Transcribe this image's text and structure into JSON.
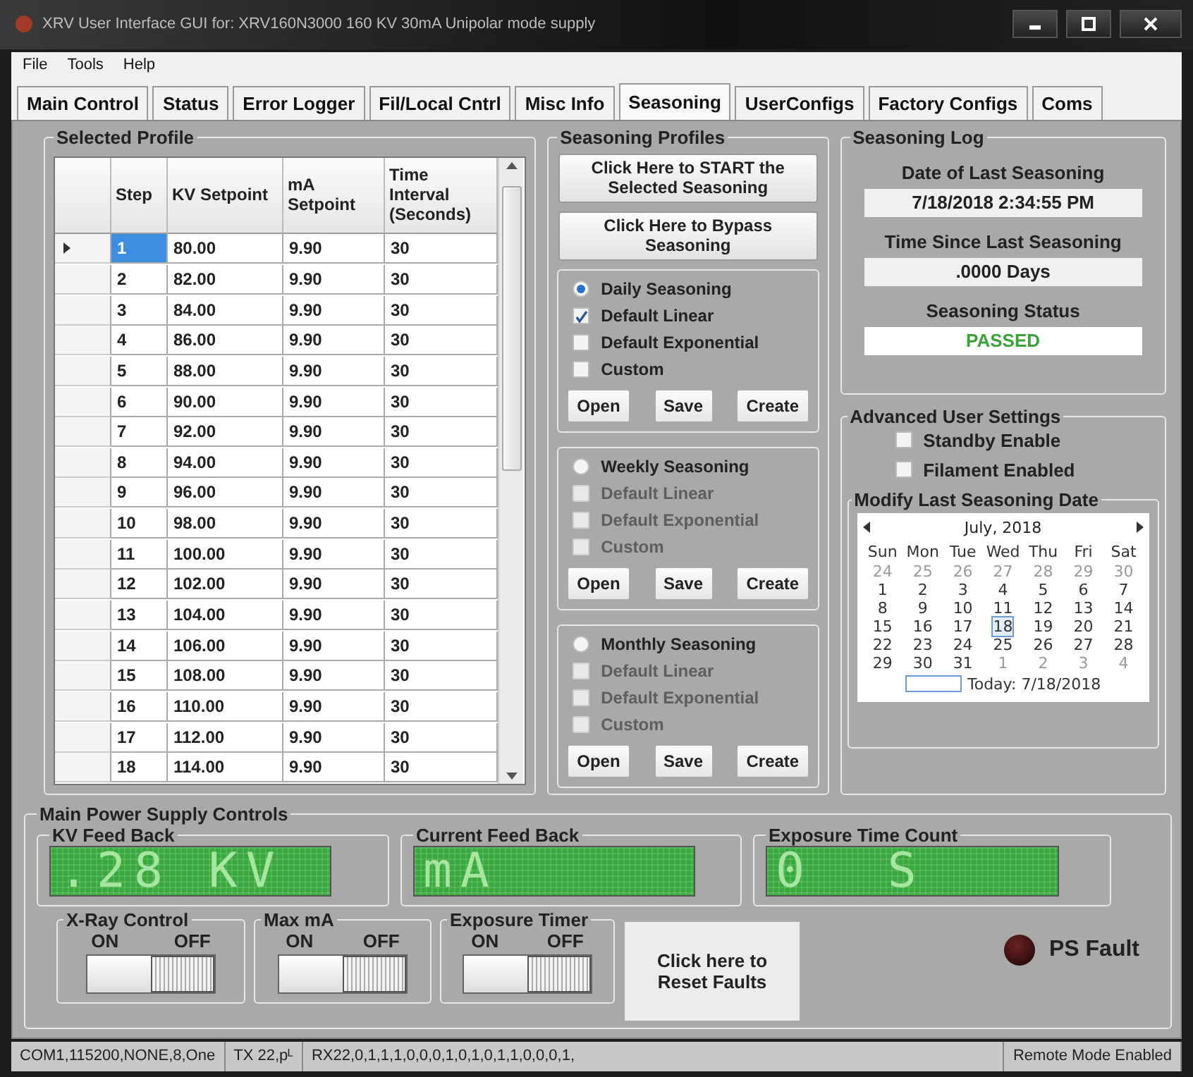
{
  "window": {
    "title": "XRV User Interface GUI for: XRV160N3000 160 KV 30mA Unipolar mode supply"
  },
  "menu": [
    "File",
    "Tools",
    "Help"
  ],
  "tabs": [
    {
      "label": "Main Control",
      "selected": false
    },
    {
      "label": "Status",
      "selected": false
    },
    {
      "label": "Error Logger",
      "selected": false
    },
    {
      "label": "Fil/Local Cntrl",
      "selected": false
    },
    {
      "label": "Misc Info",
      "selected": false
    },
    {
      "label": "Seasoning",
      "selected": true
    },
    {
      "label": "UserConfigs",
      "selected": false
    },
    {
      "label": "Factory Configs",
      "selected": false
    },
    {
      "label": "Coms",
      "selected": false
    }
  ],
  "selected_profile": {
    "title": "Selected Profile",
    "columns": [
      "Step",
      "KV Setpoint",
      "mA Setpoint",
      "Time Interval (Seconds)"
    ],
    "rows": [
      {
        "cells": [
          "1",
          "80.00",
          "9.90",
          "30"
        ],
        "selected": true
      },
      {
        "cells": [
          "2",
          "82.00",
          "9.90",
          "30"
        ],
        "selected": false
      },
      {
        "cells": [
          "3",
          "84.00",
          "9.90",
          "30"
        ],
        "selected": false
      },
      {
        "cells": [
          "4",
          "86.00",
          "9.90",
          "30"
        ],
        "selected": false
      },
      {
        "cells": [
          "5",
          "88.00",
          "9.90",
          "30"
        ],
        "selected": false
      },
      {
        "cells": [
          "6",
          "90.00",
          "9.90",
          "30"
        ],
        "selected": false
      },
      {
        "cells": [
          "7",
          "92.00",
          "9.90",
          "30"
        ],
        "selected": false
      },
      {
        "cells": [
          "8",
          "94.00",
          "9.90",
          "30"
        ],
        "selected": false
      },
      {
        "cells": [
          "9",
          "96.00",
          "9.90",
          "30"
        ],
        "selected": false
      },
      {
        "cells": [
          "10",
          "98.00",
          "9.90",
          "30"
        ],
        "selected": false
      },
      {
        "cells": [
          "11",
          "100.00",
          "9.90",
          "30"
        ],
        "selected": false
      },
      {
        "cells": [
          "12",
          "102.00",
          "9.90",
          "30"
        ],
        "selected": false
      },
      {
        "cells": [
          "13",
          "104.00",
          "9.90",
          "30"
        ],
        "selected": false
      },
      {
        "cells": [
          "14",
          "106.00",
          "9.90",
          "30"
        ],
        "selected": false
      },
      {
        "cells": [
          "15",
          "108.00",
          "9.90",
          "30"
        ],
        "selected": false
      },
      {
        "cells": [
          "16",
          "110.00",
          "9.90",
          "30"
        ],
        "selected": false
      },
      {
        "cells": [
          "17",
          "112.00",
          "9.90",
          "30"
        ],
        "selected": false
      },
      {
        "cells": [
          "18",
          "114.00",
          "9.90",
          "30"
        ],
        "selected": false
      }
    ]
  },
  "seasoning_profiles": {
    "title": "Seasoning Profiles",
    "buttons": [
      "Click Here to START the Selected Seasoning",
      "Click Here to Bypass Seasoning"
    ],
    "groups": [
      {
        "label": "Daily Seasoning",
        "selected": true,
        "disabled": false,
        "options": [
          {
            "label": "Default Linear",
            "checked": true
          },
          {
            "label": "Default Exponential",
            "checked": false
          },
          {
            "label": "Custom",
            "checked": false
          }
        ],
        "buttons": [
          "Open",
          "Save",
          "Create"
        ]
      },
      {
        "label": "Weekly Seasoning",
        "selected": false,
        "disabled": true,
        "options": [
          {
            "label": "Default Linear",
            "checked": false
          },
          {
            "label": "Default Exponential",
            "checked": false
          },
          {
            "label": "Custom",
            "checked": false
          }
        ],
        "buttons": [
          "Open",
          "Save",
          "Create"
        ]
      },
      {
        "label": "Monthly Seasoning",
        "selected": false,
        "disabled": true,
        "options": [
          {
            "label": "Default Linear",
            "checked": false
          },
          {
            "label": "Default Exponential",
            "checked": false
          },
          {
            "label": "Custom",
            "checked": false
          }
        ],
        "buttons": [
          "Open",
          "Save",
          "Create"
        ]
      }
    ]
  },
  "seasoning_log": {
    "title": "Seasoning Log",
    "fields": [
      {
        "label": "Date of Last Seasoning",
        "value": "7/18/2018 2:34:55 PM",
        "kind": "plain"
      },
      {
        "label": "Time Since Last Seasoning",
        "value": ".0000 Days",
        "kind": "plain"
      },
      {
        "label": "Seasoning Status",
        "value": "PASSED",
        "kind": "status"
      }
    ]
  },
  "advanced": {
    "title": "Advanced User Settings",
    "options": [
      {
        "label": "Standby Enable",
        "checked": false
      },
      {
        "label": "Filament Enabled",
        "checked": false
      }
    ],
    "calendar": {
      "title": "Modify Last Seasoning Date",
      "month": "July, 2018",
      "weekdays": [
        "Sun",
        "Mon",
        "Tue",
        "Wed",
        "Thu",
        "Fri",
        "Sat"
      ],
      "weeks": [
        [
          {
            "day": "24",
            "other_month": true,
            "selected": false
          },
          {
            "day": "25",
            "other_month": true,
            "selected": false
          },
          {
            "day": "26",
            "other_month": true,
            "selected": false
          },
          {
            "day": "27",
            "other_month": true,
            "selected": false
          },
          {
            "day": "28",
            "other_month": true,
            "selected": false
          },
          {
            "day": "29",
            "other_month": true,
            "selected": false
          },
          {
            "day": "30",
            "other_month": true,
            "selected": false
          }
        ],
        [
          {
            "day": "1",
            "other_month": false,
            "selected": false
          },
          {
            "day": "2",
            "other_month": false,
            "selected": false
          },
          {
            "day": "3",
            "other_month": false,
            "selected": false
          },
          {
            "day": "4",
            "other_month": false,
            "selected": false
          },
          {
            "day": "5",
            "other_month": false,
            "selected": false
          },
          {
            "day": "6",
            "other_month": false,
            "selected": false
          },
          {
            "day": "7",
            "other_month": false,
            "selected": false
          }
        ],
        [
          {
            "day": "8",
            "other_month": false,
            "selected": false
          },
          {
            "day": "9",
            "other_month": false,
            "selected": false
          },
          {
            "day": "10",
            "other_month": false,
            "selected": false
          },
          {
            "day": "11",
            "other_month": false,
            "selected": false
          },
          {
            "day": "12",
            "other_month": false,
            "selected": false
          },
          {
            "day": "13",
            "other_month": false,
            "selected": false
          },
          {
            "day": "14",
            "other_month": false,
            "selected": false
          }
        ],
        [
          {
            "day": "15",
            "other_month": false,
            "selected": false
          },
          {
            "day": "16",
            "other_month": false,
            "selected": false
          },
          {
            "day": "17",
            "other_month": false,
            "selected": false
          },
          {
            "day": "18",
            "other_month": false,
            "selected": true
          },
          {
            "day": "19",
            "other_month": false,
            "selected": false
          },
          {
            "day": "20",
            "other_month": false,
            "selected": false
          },
          {
            "day": "21",
            "other_month": false,
            "selected": false
          }
        ],
        [
          {
            "day": "22",
            "other_month": false,
            "selected": false
          },
          {
            "day": "23",
            "other_month": false,
            "selected": false
          },
          {
            "day": "24",
            "other_month": false,
            "selected": false
          },
          {
            "day": "25",
            "other_month": false,
            "selected": false
          },
          {
            "day": "26",
            "other_month": false,
            "selected": false
          },
          {
            "day": "27",
            "other_month": false,
            "selected": false
          },
          {
            "day": "28",
            "other_month": false,
            "selected": false
          }
        ],
        [
          {
            "day": "29",
            "other_month": false,
            "selected": false
          },
          {
            "day": "30",
            "other_month": false,
            "selected": false
          },
          {
            "day": "31",
            "other_month": false,
            "selected": false
          },
          {
            "day": "1",
            "other_month": true,
            "selected": false
          },
          {
            "day": "2",
            "other_month": true,
            "selected": false
          },
          {
            "day": "3",
            "other_month": true,
            "selected": false
          },
          {
            "day": "4",
            "other_month": true,
            "selected": false
          }
        ]
      ],
      "today": "Today: 7/18/2018"
    }
  },
  "power_controls": {
    "title": "Main Power Supply Controls",
    "displays": [
      {
        "title": "KV Feed Back",
        "reading": ".28 KV"
      },
      {
        "title": "Current Feed Back",
        "reading": "mA"
      },
      {
        "title": "Exposure Time Count",
        "reading": "0  S"
      }
    ],
    "switches": [
      {
        "title": "X-Ray Control",
        "on_label": "ON",
        "off_label": "OFF",
        "on": false
      },
      {
        "title": "Max mA",
        "on_label": "ON",
        "off_label": "OFF",
        "on": false
      },
      {
        "title": "Exposure Timer",
        "on_label": "ON",
        "off_label": "OFF",
        "on": false
      }
    ],
    "reset_button": "Click here to Reset Faults",
    "fault": {
      "label": "PS Fault",
      "lit": false
    }
  },
  "status_bar": [
    "COM1,115200,NONE,8,One",
    "TX  22,pᴸ",
    "RX22,0,1,1,1,0,0,0,1,0,1,0,1,1,0,0,0,1,",
    "Remote Mode Enabled"
  ]
}
